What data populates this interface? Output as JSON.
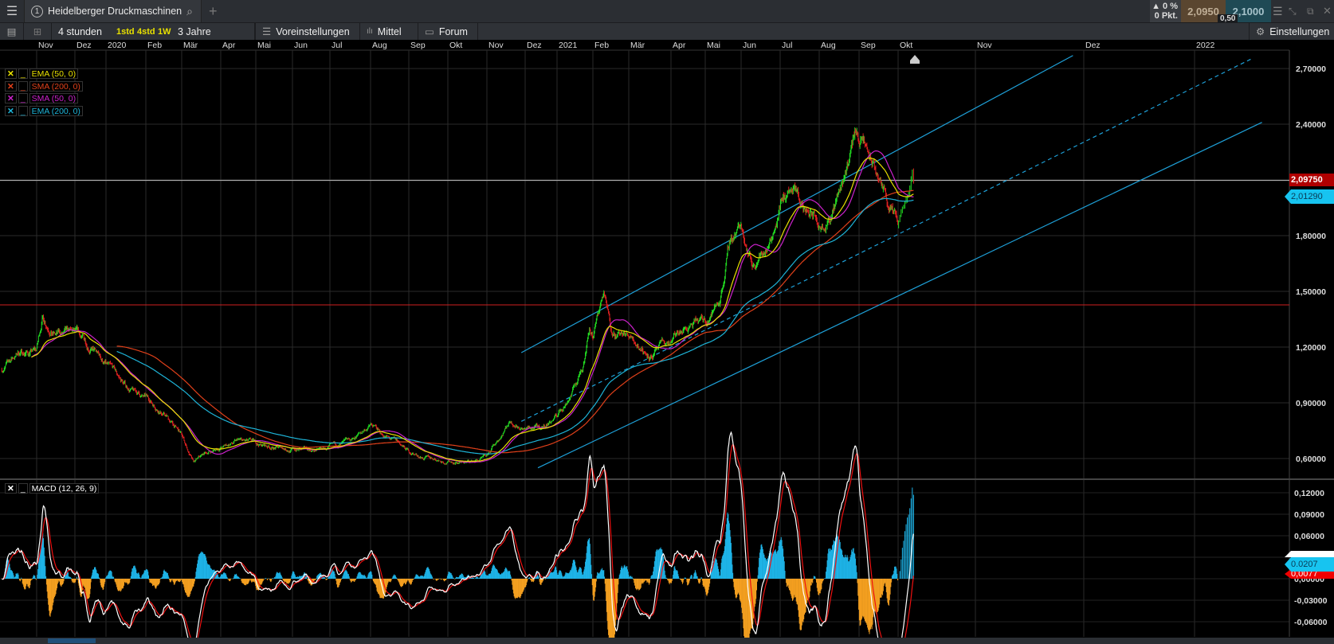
{
  "topbar": {
    "instance_number": "1",
    "instrument": "Heidelberger Druckmaschinen",
    "change_pct": "▲ 0 %",
    "change_pts": "0 Pkt.",
    "bid": "2,0950",
    "ask": "2,1000",
    "spread": "0,50"
  },
  "toolbar": {
    "interval": "4 stunden",
    "quick_1": "1std",
    "quick_2": "4std",
    "quick_3": "1W",
    "range": "3 Jahre",
    "presets": "Voreinstellungen",
    "indicators": "Mittel",
    "forum": "Forum",
    "settings": "Einstellungen"
  },
  "legend": [
    {
      "label": "EMA (50, 0)",
      "color": "#e8e000"
    },
    {
      "label": "SMA (200, 0)",
      "color": "#e0401a"
    },
    {
      "label": "SMA (50, 0)",
      "color": "#cc22cc"
    },
    {
      "label": "EMA (200, 0)",
      "color": "#1eb4d8"
    }
  ],
  "macd_legend": "MACD (12, 26, 9)",
  "chart_data": {
    "type": "candlestick",
    "x_ticks": [
      "Nov",
      "Dez",
      "2020",
      "Feb",
      "Mär",
      "Apr",
      "Mai",
      "Jun",
      "Jul",
      "Aug",
      "Sep",
      "Okt",
      "Nov",
      "Dez",
      "2021",
      "Feb",
      "Mär",
      "Apr",
      "Mai",
      "Jun",
      "Jul",
      "Aug",
      "Sep",
      "Okt",
      "Nov",
      "Dez",
      "2022"
    ],
    "price_axis": {
      "ylim": [
        0.6,
        2.7
      ],
      "ticks": [
        "2,70000",
        "2,40000",
        "2,10000",
        "1,80000",
        "1,50000",
        "1,20000",
        "0,90000",
        "0,60000"
      ],
      "tick_values": [
        2.7,
        2.4,
        2.1,
        1.8,
        1.5,
        1.2,
        0.9,
        0.6
      ]
    },
    "macd_axis": {
      "ylim": [
        -0.06,
        0.12
      ],
      "ticks": [
        "0,12000",
        "0,09000",
        "0,06000",
        "0,03000",
        "0,00000",
        "-0,03000",
        "-0,06000"
      ],
      "tick_values": [
        0.12,
        0.09,
        0.06,
        0.03,
        0,
        -0.03,
        -0.06
      ]
    },
    "price_path_months_from_nov_2019": [
      [
        -0.95,
        1.08
      ],
      [
        -0.5,
        1.17
      ],
      [
        0,
        1.18
      ],
      [
        0.15,
        1.36
      ],
      [
        0.5,
        1.28
      ],
      [
        1,
        1.25
      ],
      [
        1.5,
        1.2
      ],
      [
        2,
        1.1
      ],
      [
        2.5,
        0.98
      ],
      [
        3,
        0.92
      ],
      [
        3.5,
        0.85
      ],
      [
        4,
        0.72
      ],
      [
        4.3,
        0.57
      ],
      [
        4.6,
        0.62
      ],
      [
        5,
        0.66
      ],
      [
        5.5,
        0.69
      ],
      [
        6,
        0.67
      ],
      [
        6.5,
        0.66
      ],
      [
        7,
        0.65
      ],
      [
        7.5,
        0.64
      ],
      [
        8,
        0.65
      ],
      [
        8.5,
        0.68
      ],
      [
        9,
        0.78
      ],
      [
        9.3,
        0.73
      ],
      [
        9.7,
        0.68
      ],
      [
        10,
        0.63
      ],
      [
        10.5,
        0.6
      ],
      [
        11,
        0.59
      ],
      [
        11.5,
        0.58
      ],
      [
        12,
        0.6
      ],
      [
        12.3,
        0.7
      ],
      [
        12.6,
        0.81
      ],
      [
        13,
        0.77
      ],
      [
        13.5,
        0.76
      ],
      [
        14,
        0.83
      ],
      [
        14.3,
        0.92
      ],
      [
        14.7,
        1.08
      ],
      [
        14.9,
        1.32
      ],
      [
        15,
        1.28
      ],
      [
        15.3,
        1.5
      ],
      [
        15.5,
        1.3
      ],
      [
        16,
        1.25
      ],
      [
        16.5,
        1.17
      ],
      [
        17,
        1.22
      ],
      [
        17.5,
        1.3
      ],
      [
        18,
        1.33
      ],
      [
        18.4,
        1.45
      ],
      [
        18.7,
        1.78
      ],
      [
        19,
        1.86
      ],
      [
        19.3,
        1.66
      ],
      [
        19.7,
        1.76
      ],
      [
        20,
        2.0
      ],
      [
        20.3,
        2.04
      ],
      [
        20.6,
        1.93
      ],
      [
        21,
        1.88
      ],
      [
        21.3,
        1.96
      ],
      [
        21.6,
        2.12
      ],
      [
        21.9,
        2.36
      ],
      [
        22,
        2.34
      ],
      [
        22.3,
        2.2
      ],
      [
        22.6,
        2.05
      ],
      [
        22.8,
        1.95
      ],
      [
        23.0,
        1.83
      ],
      [
        23.1,
        1.95
      ],
      [
        23.2,
        2.0975
      ]
    ],
    "horizontal_lines": [
      {
        "value": 2.0975,
        "label": "2,09750",
        "color": "#c0c0c0"
      },
      {
        "value": 1.42719,
        "label": "1,42719",
        "color": "#d02020"
      }
    ],
    "current_labels": {
      "last": "2,09750",
      "ema200": "2,01290",
      "macd": "0.0207",
      "signal": "0,0077"
    },
    "trend_channel": {
      "upper": [
        [
          12.9,
          1.17
        ],
        [
          24.9,
          2.77
        ]
      ],
      "middle": [
        [
          12.9,
          0.8
        ],
        [
          26.5,
          2.75
        ]
      ],
      "lower": [
        [
          13.4,
          0.55
        ],
        [
          26.6,
          2.41
        ]
      ]
    },
    "macd_params": [
      12,
      26,
      9
    ]
  }
}
